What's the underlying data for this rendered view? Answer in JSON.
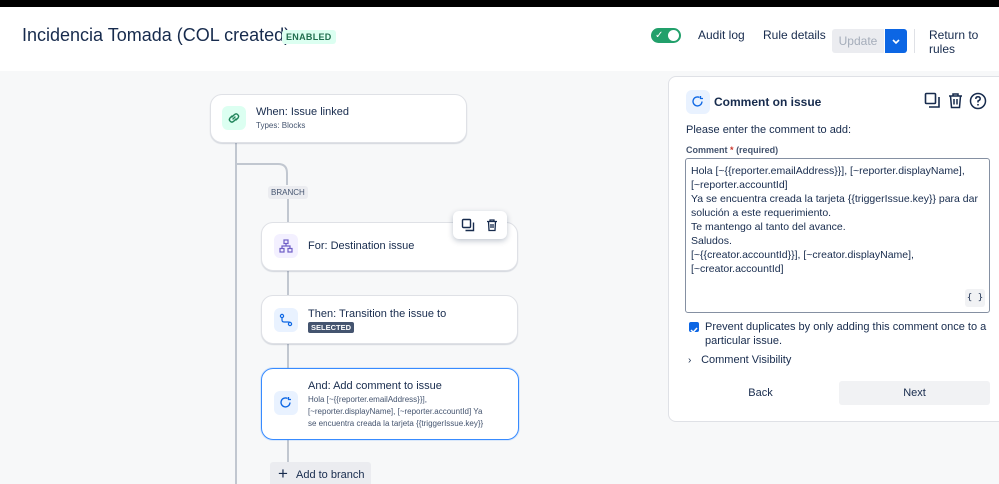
{
  "header": {
    "title": "Incidencia Tomada (COL created)",
    "status_badge": "ENABLED",
    "audit_log": "Audit log",
    "rule_details": "Rule details",
    "update": "Update",
    "return_to_rules": "Return to rules"
  },
  "flow": {
    "trigger": {
      "title": "When: Issue linked",
      "subtitle": "Types: Blocks"
    },
    "branch_tag": "BRANCH",
    "branch": {
      "title": "For: Destination issue"
    },
    "action1": {
      "title": "Then: Transition the issue to",
      "badge": "SELECTED"
    },
    "action2": {
      "title": "And: Add comment to issue",
      "body_line1": "Hola [~{{reporter.emailAddress}}],",
      "body_line2": "[~reporter.displayName], [~reporter.accountId] Ya",
      "body_line3": "se encuentra creada la tarjeta {{triggerIssue.key}}"
    },
    "add_to_branch": "Add to branch"
  },
  "panel": {
    "title": "Comment on issue",
    "prompt": "Please enter the comment to add:",
    "comment_label": "Comment",
    "required_marker": "*",
    "required_text": "(required)",
    "comment_value": "Hola [~{{reporter.emailAddress}}], [~reporter.displayName],\n[~reporter.accountId]\nYa se encuentra creada la tarjeta {{triggerIssue.key}} para dar\nsolución a este requerimiento.\nTe mantengo al tanto del avance.\nSaludos.\n[~{{creator.accountId}}], [~creator.displayName],\n[~creator.accountId]",
    "braces": "{ }",
    "prevent_duplicates_line1": "Prevent duplicates by only adding this comment once to a",
    "prevent_duplicates_line2": "particular issue.",
    "comment_visibility": "Comment Visibility",
    "back": "Back",
    "next": "Next"
  },
  "colors": {
    "accent": "#0c66e4",
    "toggle_on": "#22a06b",
    "selected_border": "#388bff"
  }
}
